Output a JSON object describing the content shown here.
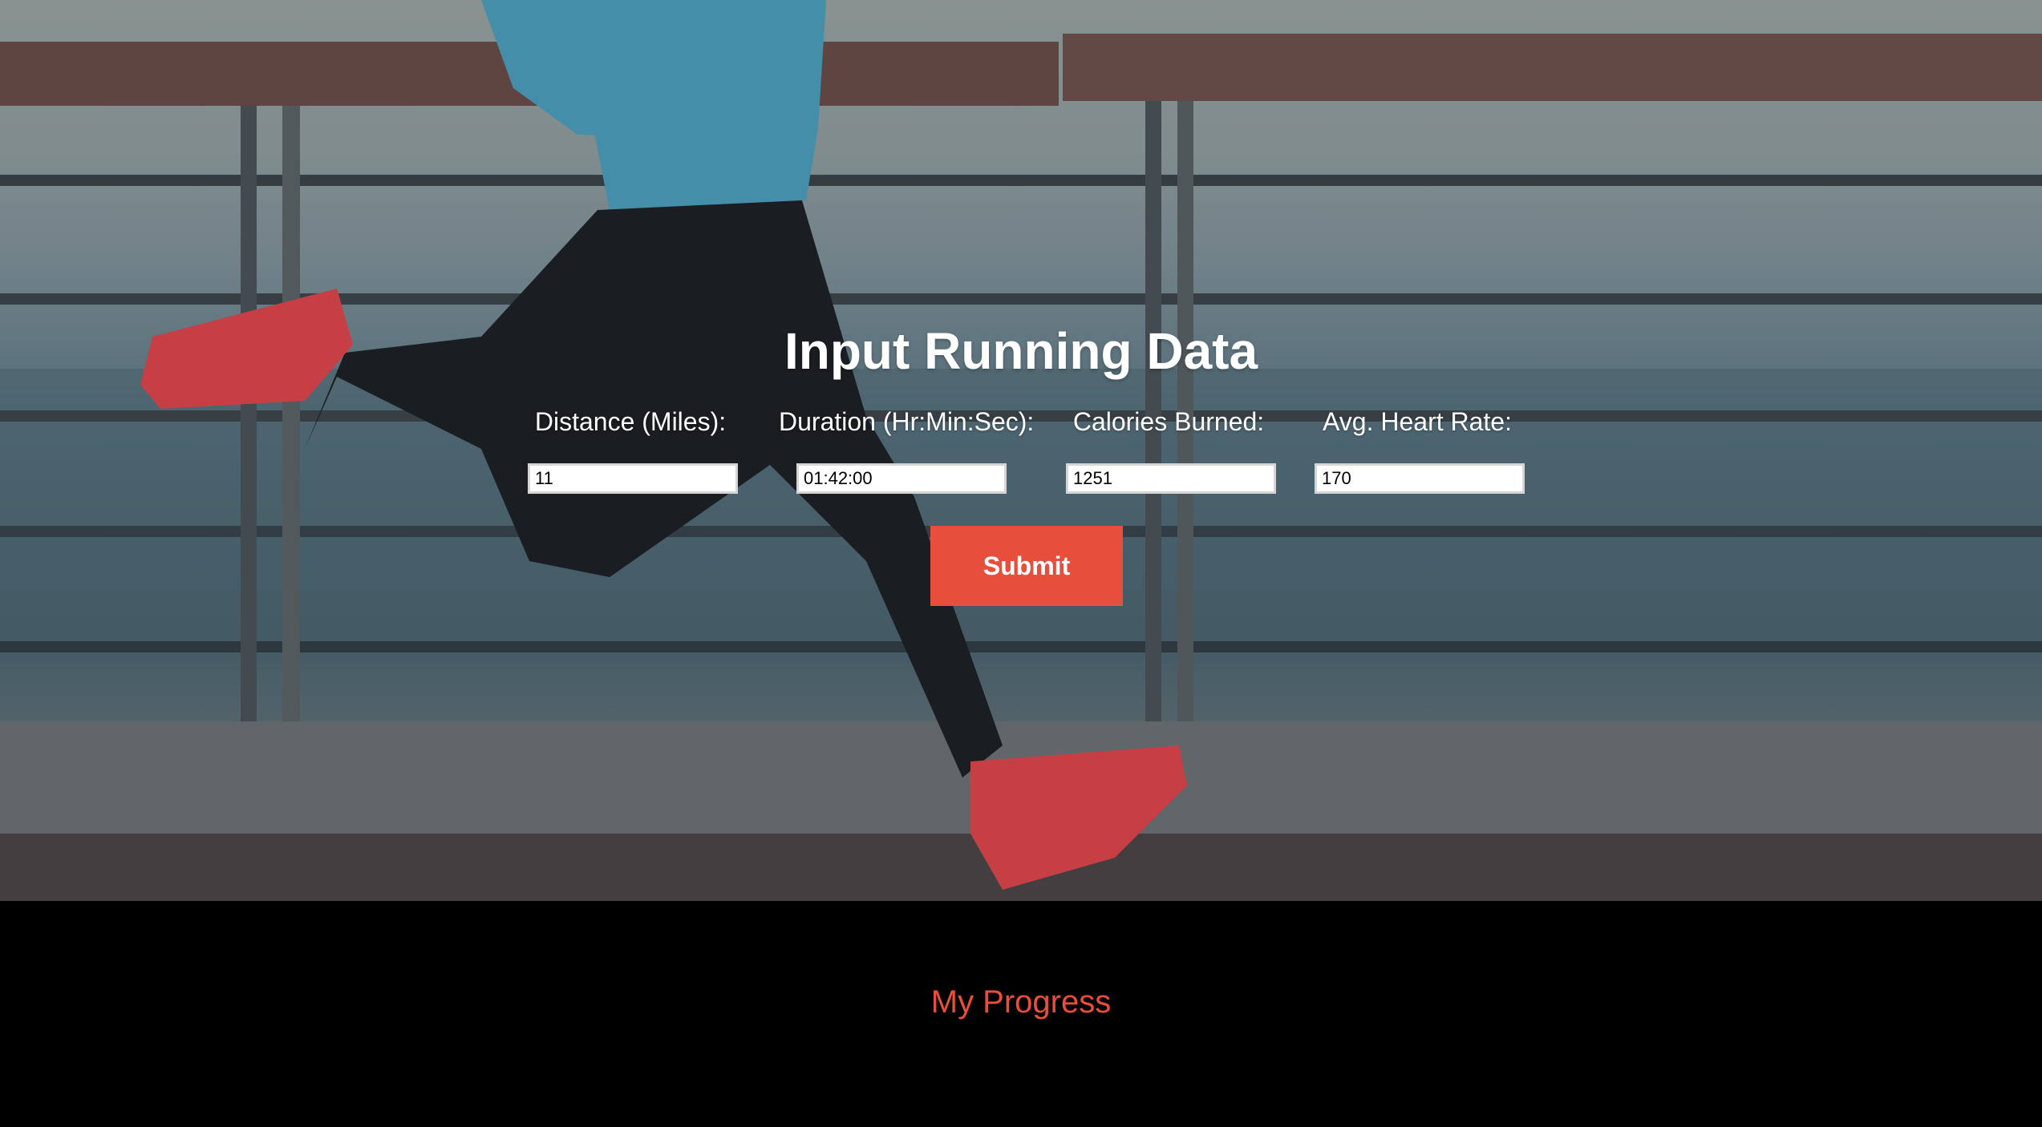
{
  "form": {
    "title": "Input Running Data",
    "fields": [
      {
        "label": "Distance (Miles):",
        "value": "11"
      },
      {
        "label": "Duration (Hr:Min:Sec):",
        "value": "01:42:00"
      },
      {
        "label": "Calories Burned:",
        "value": "1251"
      },
      {
        "label": "Avg. Heart Rate:",
        "value": "170"
      }
    ],
    "submit_label": "Submit"
  },
  "footer": {
    "progress_label": "My Progress"
  },
  "colors": {
    "accent": "#e84e3c",
    "footer_background": "#000000",
    "title_text": "#ffffff"
  },
  "icons": {
    "hero": "runner-background-image"
  }
}
